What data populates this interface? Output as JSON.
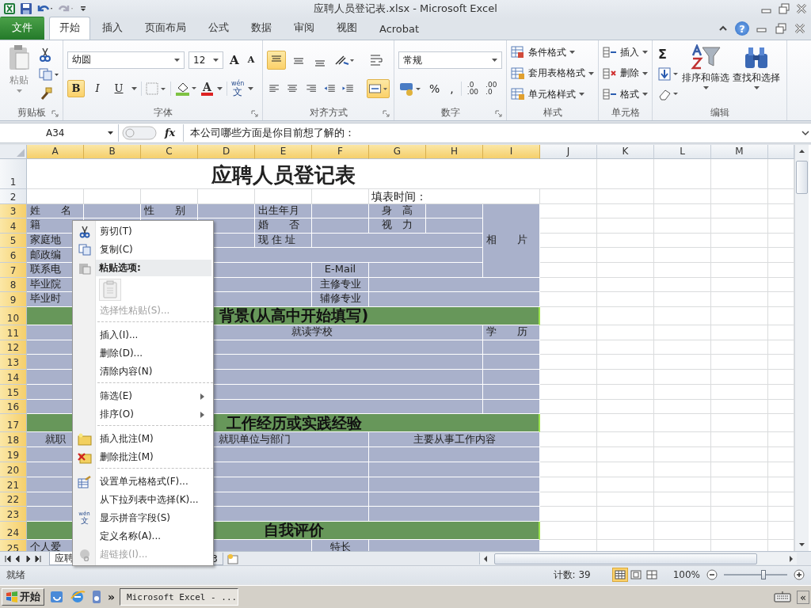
{
  "window": {
    "title": "应聘人员登记表.xlsx - Microsoft Excel",
    "help": "?"
  },
  "ribbon_tabs": [
    {
      "label": "文件",
      "kind": "file",
      "selected": false
    },
    {
      "label": "开始",
      "kind": "tab",
      "selected": true
    },
    {
      "label": "插入",
      "kind": "tab",
      "selected": false
    },
    {
      "label": "页面布局",
      "kind": "tab",
      "selected": false
    },
    {
      "label": "公式",
      "kind": "tab",
      "selected": false
    },
    {
      "label": "数据",
      "kind": "tab",
      "selected": false
    },
    {
      "label": "审阅",
      "kind": "tab",
      "selected": false
    },
    {
      "label": "视图",
      "kind": "tab",
      "selected": false
    },
    {
      "label": "Acrobat",
      "kind": "tab",
      "selected": false
    }
  ],
  "clipboard": {
    "label": "剪贴板",
    "paste": "粘贴"
  },
  "font": {
    "label": "字体",
    "family": "幼圆",
    "size": "12",
    "grow": "A",
    "shrink": "A",
    "bold": {
      "text": "B",
      "on": true
    },
    "italic": {
      "text": "I",
      "on": false
    },
    "underline": {
      "text": "U",
      "on": false
    },
    "color_text": "A",
    "phonetic": [
      "wén",
      "文"
    ]
  },
  "alignment": {
    "label": "对齐方式",
    "top": {
      "on": true
    },
    "middle": {
      "on": false
    },
    "bottom": {
      "on": false
    },
    "left": {
      "on": false
    },
    "center": {
      "on": false
    },
    "right": {
      "on": false
    },
    "merge": {
      "on": true
    }
  },
  "number": {
    "label": "数字",
    "format": "常规",
    "percent": "%",
    "comma": ",",
    "increase_decimal": [
      ".0",
      ".00"
    ],
    "decrease_decimal": [
      ".00",
      ".0"
    ]
  },
  "styles": {
    "label": "样式",
    "items": [
      "条件格式",
      "套用表格格式",
      "单元格样式"
    ]
  },
  "cells_group": {
    "label": "单元格",
    "items": [
      "插入",
      "删除",
      "格式"
    ]
  },
  "editing": {
    "label": "编辑",
    "autosum": "Σ",
    "sort": "排序和筛选",
    "find": "查找和选择"
  },
  "formula_bar": {
    "name_box": "A34",
    "fx": "fx",
    "formula": "本公司哪些方面是你目前想了解的："
  },
  "sheet": {
    "columns": [
      {
        "label": "A",
        "selected": true
      },
      {
        "label": "B",
        "selected": true
      },
      {
        "label": "C",
        "selected": true
      },
      {
        "label": "D",
        "selected": true
      },
      {
        "label": "E",
        "selected": true
      },
      {
        "label": "F",
        "selected": true
      },
      {
        "label": "G",
        "selected": true
      },
      {
        "label": "H",
        "selected": true
      },
      {
        "label": "I",
        "selected": true
      },
      {
        "label": "J",
        "selected": false
      },
      {
        "label": "K",
        "selected": false
      },
      {
        "label": "L",
        "selected": false
      },
      {
        "label": "M",
        "selected": false
      }
    ],
    "rows": [
      {
        "label": "1",
        "selected": false
      },
      {
        "label": "2",
        "selected": false
      },
      {
        "label": "3",
        "selected": true
      },
      {
        "label": "4",
        "selected": true
      },
      {
        "label": "5",
        "selected": true
      },
      {
        "label": "6",
        "selected": true
      },
      {
        "label": "7",
        "selected": true
      },
      {
        "label": "8",
        "selected": true
      },
      {
        "label": "9",
        "selected": true
      },
      {
        "label": "10",
        "selected": true
      },
      {
        "label": "11",
        "selected": true
      },
      {
        "label": "12",
        "selected": true
      },
      {
        "label": "13",
        "selected": true
      },
      {
        "label": "14",
        "selected": true
      },
      {
        "label": "15",
        "selected": true
      },
      {
        "label": "16",
        "selected": true
      },
      {
        "label": "17",
        "selected": true
      },
      {
        "label": "18",
        "selected": true
      },
      {
        "label": "19",
        "selected": true
      },
      {
        "label": "20",
        "selected": true
      },
      {
        "label": "21",
        "selected": true
      },
      {
        "label": "22",
        "selected": true
      },
      {
        "label": "23",
        "selected": true
      },
      {
        "label": "24",
        "selected": true
      },
      {
        "label": "25",
        "selected": true
      }
    ],
    "cells": [
      {
        "kind": "title",
        "text": "应聘人员登记表"
      },
      {
        "kind": "note",
        "text": "填表时间："
      },
      {
        "kind": "label",
        "text": "姓　　名"
      },
      {
        "kind": "label",
        "text": "性　　别"
      },
      {
        "kind": "label",
        "text": "出生年月"
      },
      {
        "kind": "header",
        "text": "身　高"
      },
      {
        "kind": "label",
        "text": "相　　片"
      },
      {
        "kind": "label",
        "text": "籍"
      },
      {
        "kind": "label",
        "text": "婚　　否"
      },
      {
        "kind": "header",
        "text": "视　力"
      },
      {
        "kind": "label",
        "text": "家庭地"
      },
      {
        "kind": "label",
        "text": "现 住 址"
      },
      {
        "kind": "label",
        "text": "邮政编"
      },
      {
        "kind": "label",
        "text": "联系电"
      },
      {
        "kind": "header",
        "text": "E-Mail"
      },
      {
        "kind": "label",
        "text": "毕业院"
      },
      {
        "kind": "header",
        "text": "主修专业"
      },
      {
        "kind": "label",
        "text": "毕业时"
      },
      {
        "kind": "header",
        "text": "辅修专业"
      },
      {
        "kind": "section",
        "text": "背景(从高中开始填写)"
      },
      {
        "kind": "header",
        "text": "就读学校"
      },
      {
        "kind": "label",
        "text": "学　　历"
      },
      {
        "kind": "section",
        "text": "工作经历或实践经验"
      },
      {
        "kind": "header",
        "text": "就职"
      },
      {
        "kind": "header",
        "text": "就职单位与部门"
      },
      {
        "kind": "header",
        "text": "主要从事工作内容"
      },
      {
        "kind": "section",
        "text": "自我评价"
      },
      {
        "kind": "label",
        "text": "个人爱"
      },
      {
        "kind": "header",
        "text": "特长"
      }
    ]
  },
  "context_menu": {
    "items": [
      {
        "kind": "item",
        "label": "剪切(T)",
        "disabled": false,
        "submenu": false
      },
      {
        "kind": "item",
        "label": "复制(C)",
        "disabled": false,
        "submenu": false
      },
      {
        "kind": "header",
        "label": "粘贴选项:"
      },
      {
        "kind": "paste_options"
      },
      {
        "kind": "item",
        "label": "选择性粘贴(S)...",
        "disabled": true,
        "submenu": false
      },
      {
        "kind": "separator"
      },
      {
        "kind": "item",
        "label": "插入(I)...",
        "disabled": false,
        "submenu": false
      },
      {
        "kind": "item",
        "label": "删除(D)...",
        "disabled": false,
        "submenu": false
      },
      {
        "kind": "item",
        "label": "清除内容(N)",
        "disabled": false,
        "submenu": false
      },
      {
        "kind": "separator"
      },
      {
        "kind": "item",
        "label": "筛选(E)",
        "disabled": false,
        "submenu": true
      },
      {
        "kind": "item",
        "label": "排序(O)",
        "disabled": false,
        "submenu": true
      },
      {
        "kind": "separator"
      },
      {
        "kind": "item",
        "label": "插入批注(M)",
        "disabled": false,
        "submenu": false
      },
      {
        "kind": "item",
        "label": "删除批注(M)",
        "disabled": false,
        "submenu": false
      },
      {
        "kind": "separator"
      },
      {
        "kind": "item",
        "label": "设置单元格格式(F)...",
        "disabled": false,
        "submenu": false
      },
      {
        "kind": "item",
        "label": "从下拉列表中选择(K)...",
        "disabled": false,
        "submenu": false
      },
      {
        "kind": "item",
        "label": "显示拼音字段(S)",
        "disabled": false,
        "submenu": false,
        "icon_text": [
          "wén",
          "文"
        ]
      },
      {
        "kind": "item",
        "label": "定义名称(A)...",
        "disabled": false,
        "submenu": false
      },
      {
        "kind": "item",
        "label": "超链接(I)...",
        "disabled": true,
        "submenu": false
      }
    ]
  },
  "sheet_tabs": [
    {
      "label": "应聘",
      "selected": true
    },
    {
      "label": "3",
      "selected": false
    }
  ],
  "status_bar": {
    "mode": "就绪",
    "count": "计数: 39",
    "views": [
      {
        "kind": "normal",
        "selected": true
      },
      {
        "kind": "layout",
        "selected": false
      },
      {
        "kind": "pagebreak",
        "selected": false
      }
    ],
    "zoom": "100%",
    "level": 0.63
  },
  "taskbar": {
    "start": "开始",
    "more": "»",
    "tasks": [
      {
        "label": "Microsoft Excel - ...",
        "selected": true
      }
    ],
    "tray_toggle": "«"
  }
}
